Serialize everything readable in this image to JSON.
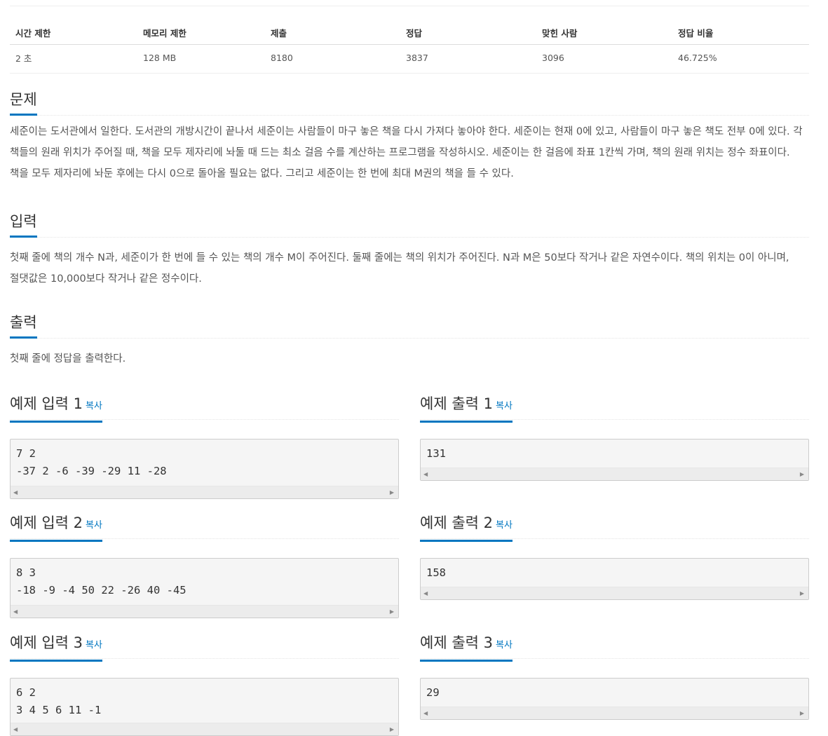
{
  "stats": {
    "headers": [
      "시간 제한",
      "메모리 제한",
      "제출",
      "정답",
      "맞힌 사람",
      "정답 비율"
    ],
    "values": [
      "2 초",
      "128 MB",
      "8180",
      "3837",
      "3096",
      "46.725%"
    ]
  },
  "problem": {
    "title": "문제",
    "text": "세준이는 도서관에서 일한다. 도서관의 개방시간이 끝나서 세준이는 사람들이 마구 놓은 책을 다시 가져다 놓아야 한다. 세준이는 현재 0에 있고, 사람들이 마구 놓은 책도 전부 0에 있다. 각 책들의 원래 위치가 주어질 때, 책을 모두 제자리에 놔둘 때 드는 최소 걸음 수를 계산하는 프로그램을 작성하시오. 세준이는 한 걸음에 좌표 1칸씩 가며, 책의 원래 위치는 정수 좌표이다. 책을 모두 제자리에 놔둔 후에는 다시 0으로 돌아올 필요는 없다. 그리고 세준이는 한 번에 최대 M권의 책을 들 수 있다."
  },
  "input": {
    "title": "입력",
    "text": "첫째 줄에 책의 개수 N과, 세준이가 한 번에 들 수 있는 책의 개수 M이 주어진다. 둘째 줄에는 책의 위치가 주어진다. N과 M은 50보다 작거나 같은 자연수이다. 책의 위치는 0이 아니며, 절댓값은 10,000보다 작거나 같은 정수이다."
  },
  "output": {
    "title": "출력",
    "text": "첫째 줄에 정답을 출력한다."
  },
  "copy_label": "복사",
  "examples": [
    {
      "in_title": "예제 입력 1",
      "out_title": "예제 출력 1",
      "input": "7 2\n-37 2 -6 -39 -29 11 -28",
      "output": "131"
    },
    {
      "in_title": "예제 입력 2",
      "out_title": "예제 출력 2",
      "input": "8 3\n-18 -9 -4 50 22 -26 40 -45",
      "output": "158"
    },
    {
      "in_title": "예제 입력 3",
      "out_title": "예제 출력 3",
      "input": "6 2\n3 4 5 6 11 -1",
      "output": "29"
    }
  ],
  "colors": {
    "accent": "#0076c0",
    "code_bg": "#f5f5f5"
  }
}
